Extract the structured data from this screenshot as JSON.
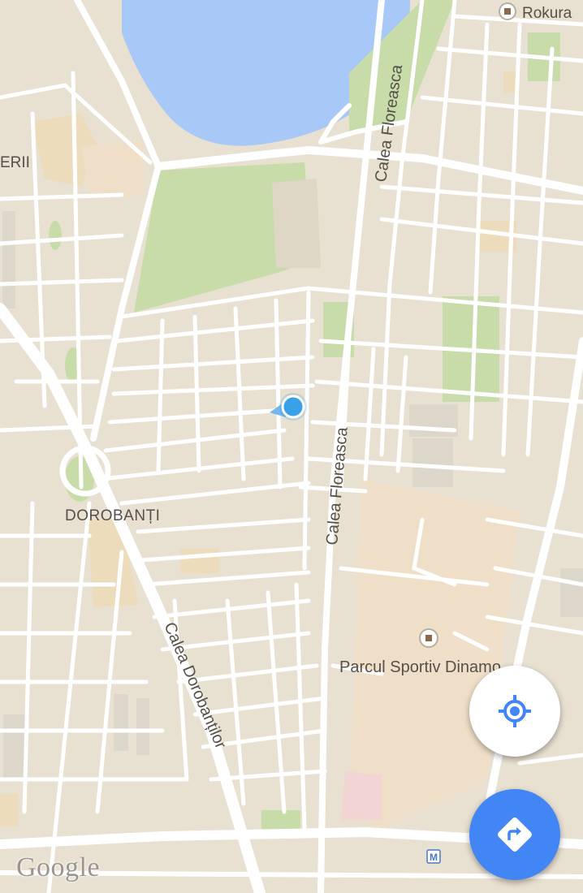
{
  "map": {
    "labels": {
      "rokura": "Rokura",
      "eri": "ERII",
      "calea_floreasca_top": "Calea Floreasca",
      "calea_floreasca_mid": "Calea Floreasca",
      "dorobanti": "DOROBANȚI",
      "calea_dorobantilor": "Calea Dorobanților",
      "parcul_sportiv": "Parcul Sportiv Dinamo"
    },
    "colors": {
      "land": "#e8e0d0",
      "road": "#ffffff",
      "water": "#a8c8f8",
      "park": "#c8dcaa",
      "block": "#dfd7c6",
      "sport": "#efdfc8",
      "location": "#3aa0e8",
      "accent": "#4285f4"
    },
    "metro_glyph": "M"
  },
  "controls": {
    "locate_icon": "my-location-icon",
    "directions_icon": "directions-icon"
  },
  "attribution": {
    "logo": "Google"
  }
}
